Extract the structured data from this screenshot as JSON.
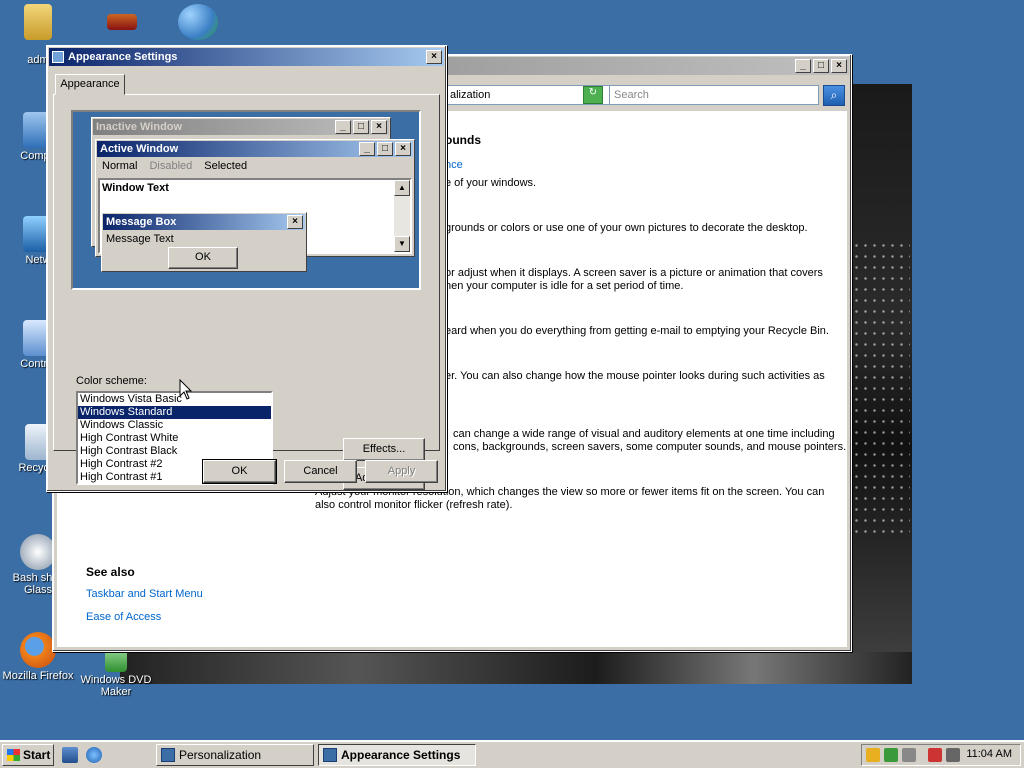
{
  "desktop": {
    "icons": [
      {
        "label": "adm",
        "name": "folder"
      },
      {
        "label": "Compu",
        "name": "computer"
      },
      {
        "label": "Netw",
        "name": "network"
      },
      {
        "label": "Control",
        "name": "control-panel"
      },
      {
        "label": "Recycle",
        "name": "recycle-bin"
      },
      {
        "label": "Bash shell",
        "label2": "Glass",
        "name": "bash-shell"
      },
      {
        "label": "Mozilla Firefox",
        "name": "firefox"
      },
      {
        "label": "Windows DVD",
        "label2": "Maker",
        "name": "dvd-maker"
      }
    ]
  },
  "personalization": {
    "address_text": "alization",
    "search_placeholder": "Search",
    "heading": "ounds",
    "link1": "nce",
    "lines": [
      "e of your windows.",
      "grounds or colors or use one of your own pictures to decorate the desktop.",
      "or adjust when it displays. A screen saver is a picture or animation that covers",
      "hen your computer is idle for a set period of time.",
      "eard when you do everything from getting e-mail to emptying your Recycle Bin.",
      "er. You can also change how the mouse pointer looks during such activities as",
      "can change a wide range of visual and auditory elements at one time including",
      "cons, backgrounds, screen savers, some computer sounds, and mouse pointers.",
      "Adjust your monitor resolution, which changes the view so more or fewer items fit on the screen. You can",
      "also control monitor flicker (refresh rate)."
    ],
    "see_also": "See also",
    "see_also_links": [
      "Taskbar and Start Menu",
      "Ease of Access"
    ]
  },
  "appearance": {
    "title": "Appearance Settings",
    "tab": "Appearance",
    "preview": {
      "inactive_title": "Inactive Window",
      "active_title": "Active Window",
      "menu": [
        "Normal",
        "Disabled",
        "Selected"
      ],
      "window_text": "Window Text",
      "msgbox_title": "Message Box",
      "msgbox_text": "Message Text",
      "msgbox_ok": "OK"
    },
    "color_scheme_label": "Color scheme:",
    "schemes": [
      "Windows Vista Basic",
      "Windows Standard",
      "Windows Classic",
      "High Contrast White",
      "High Contrast Black",
      "High Contrast #2",
      "High Contrast #1"
    ],
    "selected_scheme": "Windows Standard",
    "effects": "Effects...",
    "advanced": "Advanced...",
    "ok": "OK",
    "cancel": "Cancel",
    "apply": "Apply"
  },
  "taskbar": {
    "start": "Start",
    "tasks": [
      "Personalization",
      "Appearance Settings"
    ],
    "active_task": "Appearance Settings",
    "clock": "11:04 AM"
  },
  "colors": {
    "desktop": "#3a6ea5",
    "title_active": "#0a246a",
    "face": "#d4d0c8",
    "link": "#0066cc"
  }
}
